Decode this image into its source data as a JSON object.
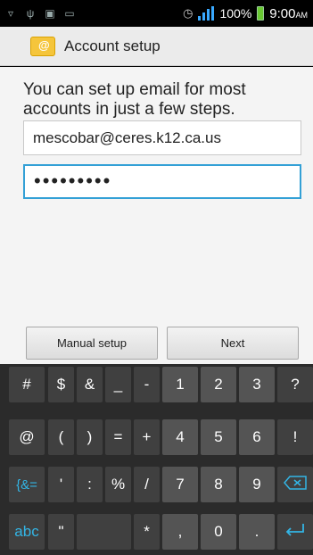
{
  "status_bar": {
    "battery_percent": "100%",
    "time": "9:00",
    "time_suffix": "AM",
    "icons": [
      "usb-icon",
      "debug-icon",
      "image-icon",
      "keyboard-icon",
      "alarm-icon",
      "signal-icon",
      "battery-icon"
    ]
  },
  "action_bar": {
    "title": "Account setup",
    "icon": "email-app-icon"
  },
  "main": {
    "instructions": "You can set up email for most accounts in just a few steps.",
    "email_value": "mescobar@ceres.k12.ca.us",
    "password_value": "•••••••••",
    "manual_setup_label": "Manual setup",
    "next_label": "Next"
  },
  "keyboard": {
    "row1": [
      "#",
      "$",
      "&",
      "_",
      "-",
      "1",
      "2",
      "3",
      "?"
    ],
    "row2": [
      "@",
      "(",
      ")",
      "=",
      "+",
      "4",
      "5",
      "6",
      "!"
    ],
    "row3": [
      "{&=",
      "'",
      ":",
      "%",
      "/",
      "7",
      "8",
      "9"
    ],
    "row4": [
      "abc",
      "\"",
      "*",
      ",",
      "0",
      "."
    ],
    "icons": [
      "backspace-icon",
      "enter-icon"
    ],
    "accent_color": "#33b5e5"
  }
}
